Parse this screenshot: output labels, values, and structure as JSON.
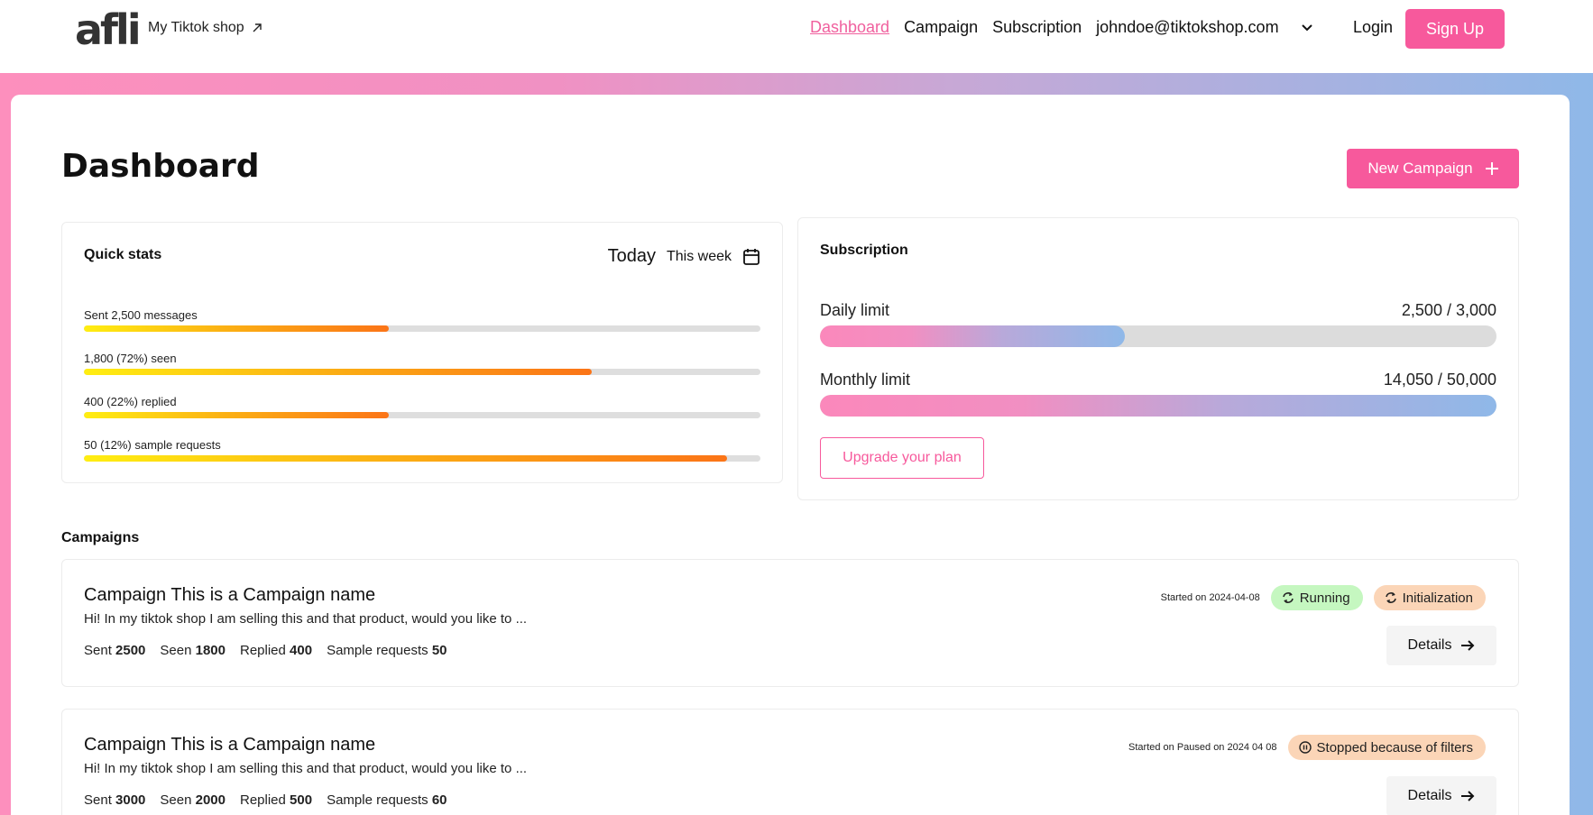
{
  "header": {
    "logo": "afli",
    "shop_link": "My Tiktok shop",
    "nav": {
      "dashboard": "Dashboard",
      "campaign": "Campaign",
      "subscription": "Subscription",
      "account": "johndoe@tiktokshop.com"
    },
    "login": "Login",
    "signup": "Sign Up"
  },
  "page": {
    "title": "Dashboard",
    "new_campaign": "New Campaign"
  },
  "quick_stats": {
    "title": "Quick stats",
    "range_today": "Today",
    "range_week": "This week",
    "items": [
      {
        "label": "Sent 2,500 messages",
        "fraction": 0.45
      },
      {
        "label": "1,800 (72%) seen",
        "fraction": 0.75
      },
      {
        "label": "400 (22%) replied",
        "fraction": 0.45
      },
      {
        "label": "50 (12%) sample requests",
        "fraction": 0.95
      }
    ]
  },
  "subscription": {
    "title": "Subscription",
    "daily": {
      "label": "Daily limit",
      "value": "2,500 / 3,000",
      "fraction": 0.45
    },
    "monthly": {
      "label": "Monthly limit",
      "value": "14,050 / 50,000",
      "fraction": 1.0
    },
    "upgrade": "Upgrade your plan"
  },
  "campaigns": {
    "title": "Campaigns",
    "items": [
      {
        "name": "Campaign This is a Campaign name",
        "message": "Hi! In my tiktok shop I am selling this and that product, would you like to ...",
        "started": "Started on 2024-04-08",
        "badges": [
          {
            "label": "Running",
            "icon": "refresh-icon",
            "color": "#c5f7c0"
          },
          {
            "label": "Initialization",
            "icon": "refresh-icon",
            "color": "#fbd5b7"
          }
        ],
        "stats": {
          "sent_label": "Sent",
          "sent": "2500",
          "seen_label": "Seen",
          "seen": "1800",
          "replied_label": "Replied",
          "replied": "400",
          "samples_label": "Sample requests",
          "samples": "50"
        },
        "details": "Details"
      },
      {
        "name": "Campaign This is a Campaign name",
        "message": "Hi! In my tiktok shop I am selling this and that product, would you like to ...",
        "started": "Started on Paused on 2024 04 08",
        "badges": [
          {
            "label": "Stopped because of filters",
            "icon": "pause-icon",
            "color": "#fbd5b7"
          }
        ],
        "stats": {
          "sent_label": "Sent",
          "sent": "3000",
          "seen_label": "Seen",
          "seen": "2000",
          "replied_label": "Replied",
          "replied": "500",
          "samples_label": "Sample requests",
          "samples": "60"
        },
        "details": "Details"
      }
    ]
  },
  "colors": {
    "accent": "#f7599c",
    "gradient_start": "#fd8fbd",
    "gradient_end": "#8fb8e8",
    "bar_start": "#ffee12",
    "bar_end": "#fb7417"
  }
}
